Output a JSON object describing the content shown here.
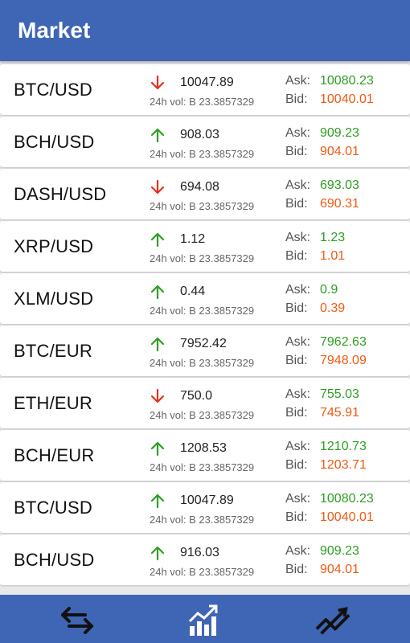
{
  "header": {
    "title": "Market"
  },
  "colors": {
    "up": "#2e9e24",
    "down": "#e5311e",
    "ask": "#2e9e24",
    "bid": "#f05a14",
    "bar": "#3f65b5"
  },
  "labels": {
    "ask": "Ask:",
    "bid": "Bid:",
    "vol_prefix": "24h vol: B"
  },
  "rows": [
    {
      "pair": "BTC/USD",
      "direction": "down",
      "price": "10047.89",
      "volume": "24h vol: B 23.3857329",
      "ask": "10080.23",
      "bid": "10040.01"
    },
    {
      "pair": "BCH/USD",
      "direction": "up",
      "price": "908.03",
      "volume": "24h vol: B 23.3857329",
      "ask": "909.23",
      "bid": "904.01"
    },
    {
      "pair": "DASH/USD",
      "direction": "down",
      "price": "694.08",
      "volume": "24h vol: B 23.3857329",
      "ask": "693.03",
      "bid": "690.31"
    },
    {
      "pair": "XRP/USD",
      "direction": "up",
      "price": "1.12",
      "volume": "24h vol: B 23.3857329",
      "ask": "1.23",
      "bid": "1.01"
    },
    {
      "pair": "XLM/USD",
      "direction": "up",
      "price": "0.44",
      "volume": "24h vol: B 23.3857329",
      "ask": "0.9",
      "bid": "0.39"
    },
    {
      "pair": "BTC/EUR",
      "direction": "up",
      "price": "7952.42",
      "volume": "24h vol: B 23.3857329",
      "ask": "7962.63",
      "bid": "7948.09"
    },
    {
      "pair": "ETH/EUR",
      "direction": "down",
      "price": "750.0",
      "volume": "24h vol: B 23.3857329",
      "ask": "755.03",
      "bid": "745.91"
    },
    {
      "pair": "BCH/EUR",
      "direction": "up",
      "price": "1208.53",
      "volume": "24h vol: B 23.3857329",
      "ask": "1210.73",
      "bid": "1203.71"
    },
    {
      "pair": "BTC/USD",
      "direction": "up",
      "price": "10047.89",
      "volume": "24h vol: B 23.3857329",
      "ask": "10080.23",
      "bid": "10040.01"
    },
    {
      "pair": "BCH/USD",
      "direction": "up",
      "price": "916.03",
      "volume": "24h vol: B 23.3857329",
      "ask": "909.23",
      "bid": "904.01"
    }
  ],
  "bottom_nav": [
    {
      "icon": "exchange-arrows-icon"
    },
    {
      "icon": "chart-growth-icon"
    },
    {
      "icon": "trend-lines-icon"
    }
  ]
}
